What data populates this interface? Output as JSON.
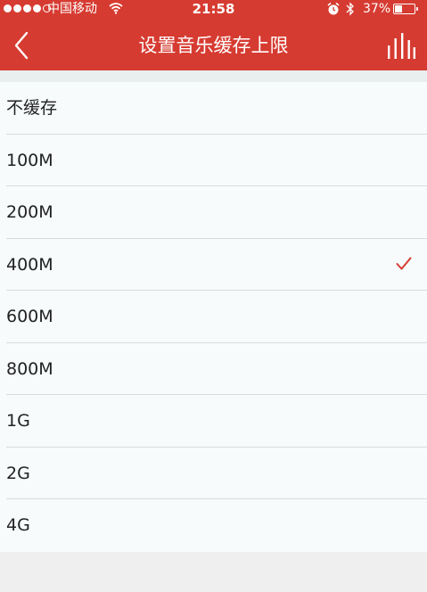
{
  "status_bar": {
    "carrier": "中国移动",
    "time": "21:58",
    "battery_percent_label": "37%",
    "battery_level": 0.37,
    "icons": [
      "signal-dots",
      "wifi-icon",
      "alarm-icon",
      "bluetooth-icon",
      "battery-icon"
    ]
  },
  "nav": {
    "title": "设置音乐缓存上限",
    "back_icon": "chevron-left-icon",
    "right_icon": "equalizer-icon"
  },
  "options": [
    {
      "label": "不缓存",
      "selected": false
    },
    {
      "label": "100M",
      "selected": false
    },
    {
      "label": "200M",
      "selected": false
    },
    {
      "label": "400M",
      "selected": true
    },
    {
      "label": "600M",
      "selected": false
    },
    {
      "label": "800M",
      "selected": false
    },
    {
      "label": "1G",
      "selected": false
    },
    {
      "label": "2G",
      "selected": false
    },
    {
      "label": "4G",
      "selected": false
    }
  ],
  "colors": {
    "header": "#d63b31",
    "check": "#d63b31",
    "list_bg": "#f7fbfc",
    "page_bg": "#efeff0"
  }
}
